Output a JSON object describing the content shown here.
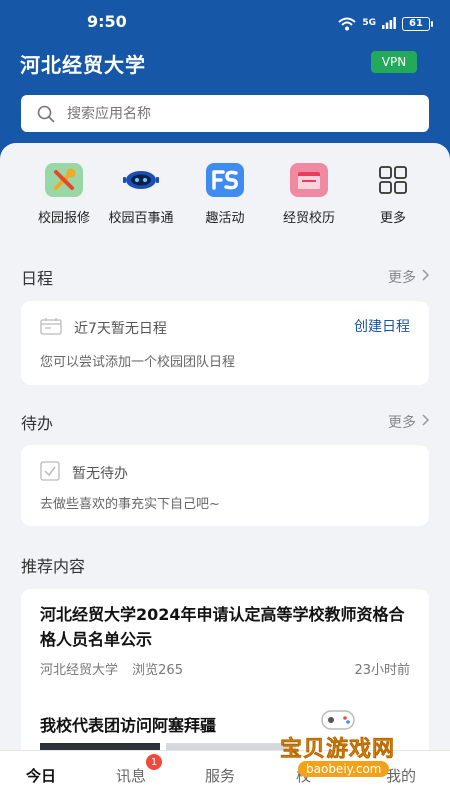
{
  "status": {
    "time": "9:50",
    "signal": "5G",
    "battery": "61"
  },
  "header": {
    "title": "河北经贸大学",
    "vpn": "VPN"
  },
  "search": {
    "placeholder": "搜索应用名称"
  },
  "quick_apps": [
    {
      "label": "校园报修",
      "icon": "repair-tools-icon",
      "color": "#9ad7a6"
    },
    {
      "label": "校园百事通",
      "icon": "robot-icon",
      "color": "#1c4fb5"
    },
    {
      "label": "趣活动",
      "icon": "fun-activity-icon",
      "color": "#3f8cf0"
    },
    {
      "label": "经贸校历",
      "icon": "calendar-folder-icon",
      "color": "#f08aa2"
    },
    {
      "label": "更多",
      "icon": "grid-icon",
      "color": "#333333"
    }
  ],
  "schedule": {
    "title": "日程",
    "more": "更多",
    "empty": "近7天暂无日程",
    "create": "创建日程",
    "hint": "您可以尝试添加一个校园团队日程"
  },
  "todo": {
    "title": "待办",
    "more": "更多",
    "empty": "暂无待办",
    "hint": "去做些喜欢的事充实下自己吧~"
  },
  "recommend": {
    "title": "推荐内容",
    "items": [
      {
        "title": "河北经贸大学2024年申请认定高等学校教师资格合格人员名单公示",
        "source": "河北经贸大学",
        "views": "浏览265",
        "time": "23小时前"
      },
      {
        "title": "我校代表团访问阿塞拜疆"
      }
    ]
  },
  "tabbar": {
    "tabs": [
      {
        "label": "今日",
        "active": true
      },
      {
        "label": "讯息",
        "badge": "1"
      },
      {
        "label": "服务"
      },
      {
        "label": "校"
      },
      {
        "label": "我的"
      }
    ]
  },
  "watermark": {
    "text": "宝贝游戏网",
    "url": "baobeiy.com"
  },
  "colors": {
    "primary": "#1657a8",
    "vpn": "#23a95a",
    "badge": "#f04a3e"
  }
}
